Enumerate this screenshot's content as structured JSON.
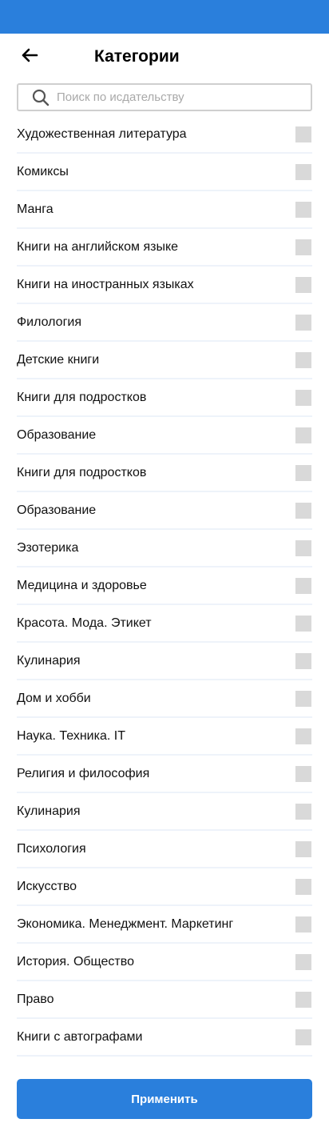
{
  "colors": {
    "status_bar": "#2a7fdc",
    "accent": "#2a7fdc",
    "checkbox": "#d9d9d9",
    "divider": "#eef3fa"
  },
  "header": {
    "back_icon": "arrow-left-icon",
    "title": "Категории"
  },
  "search": {
    "icon": "search-icon",
    "placeholder": "Поиск по исдательству",
    "value": ""
  },
  "categories": [
    {
      "label": "Художественная литература",
      "checked": false
    },
    {
      "label": "Комиксы",
      "checked": false
    },
    {
      "label": "Манга",
      "checked": false
    },
    {
      "label": "Книги на английском языке",
      "checked": false
    },
    {
      "label": "Книги на иностранных языках",
      "checked": false
    },
    {
      "label": "Филология",
      "checked": false
    },
    {
      "label": "Детские книги",
      "checked": false
    },
    {
      "label": "Книги для подростков",
      "checked": false
    },
    {
      "label": "Образование",
      "checked": false
    },
    {
      "label": "Книги для подростков",
      "checked": false
    },
    {
      "label": "Образование",
      "checked": false
    },
    {
      "label": "Эзотерика",
      "checked": false
    },
    {
      "label": "Медицина и здоровье",
      "checked": false
    },
    {
      "label": "Красота. Мода. Этикет",
      "checked": false
    },
    {
      "label": "Кулинария",
      "checked": false
    },
    {
      "label": "Дом и хобби",
      "checked": false
    },
    {
      "label": "Наука. Техника. IT",
      "checked": false
    },
    {
      "label": "Религия и философия",
      "checked": false
    },
    {
      "label": "Кулинария",
      "checked": false
    },
    {
      "label": "Психология",
      "checked": false
    },
    {
      "label": "Искусство",
      "checked": false
    },
    {
      "label": "Экономика. Менеджмент. Маркетинг",
      "checked": false
    },
    {
      "label": "История. Общество",
      "checked": false
    },
    {
      "label": "Право",
      "checked": false
    },
    {
      "label": "Книги с автографами",
      "checked": false
    }
  ],
  "apply_button": {
    "label": "Применить"
  }
}
